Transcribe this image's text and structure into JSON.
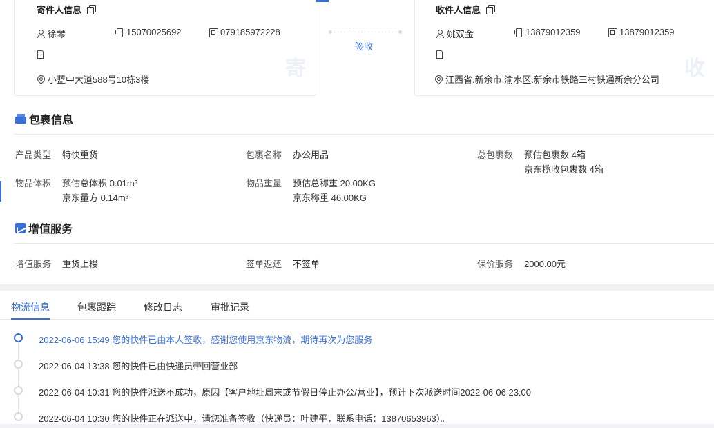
{
  "sender": {
    "title": "寄件人信息",
    "name": "徐琴",
    "mobile": "15070025692",
    "phone": "079185972228",
    "address": "小蓝中大道588号10栋3楼",
    "watermark": "寄"
  },
  "route": {
    "sign_label": "签收"
  },
  "receiver": {
    "title": "收件人信息",
    "name": "姚双金",
    "mobile": "13879012359",
    "phone": "13879012359",
    "address": "江西省.新余市.渝水区.新余市铁路三村铁通新余分公司",
    "watermark": "收"
  },
  "package": {
    "title": "包裹信息",
    "product_type": {
      "label": "产品类型",
      "value": "特快重货"
    },
    "package_name": {
      "label": "包裹名称",
      "value": "办公用品"
    },
    "total_packages": {
      "label": "总包裹数",
      "value1": "预估包裹数 4箱",
      "value2": "京东揽收包裹数 4箱"
    },
    "volume": {
      "label": "物品体积",
      "value1": "预估总体积 0.01m³",
      "value2": "京东量方 0.14m³"
    },
    "weight": {
      "label": "物品重量",
      "value1": "预估总称重 20.00KG",
      "value2": "京东称重 46.00KG"
    }
  },
  "value_added": {
    "title": "增值服务",
    "service": {
      "label": "增值服务",
      "value": "重货上楼"
    },
    "receipt": {
      "label": "签单返还",
      "value": "不签单"
    },
    "insurance": {
      "label": "保价服务",
      "value": "2000.00元"
    }
  },
  "tabs": [
    "物流信息",
    "包裹跟踪",
    "修改日志",
    "审批记录"
  ],
  "timeline": [
    "2022-06-06 15:49 您的快件已由本人签收，感谢您使用京东物流，期待再次为您服务",
    "2022-06-04 13:38 您的快件已由快递员带回营业部",
    "2022-06-04 10:31 您的快件派送不成功，原因【客户地址周末或节假日停止办公/营业】，预计下次派送时间2022-06-06 23:00",
    "2022-06-04 10:30 您的快件正在派送中，请您准备签收（快递员：叶建平，联系电话：13870653963）。"
  ],
  "colors": {
    "accent": "#3a6fd8",
    "muted": "#555555",
    "border": "#e8e8e8"
  }
}
